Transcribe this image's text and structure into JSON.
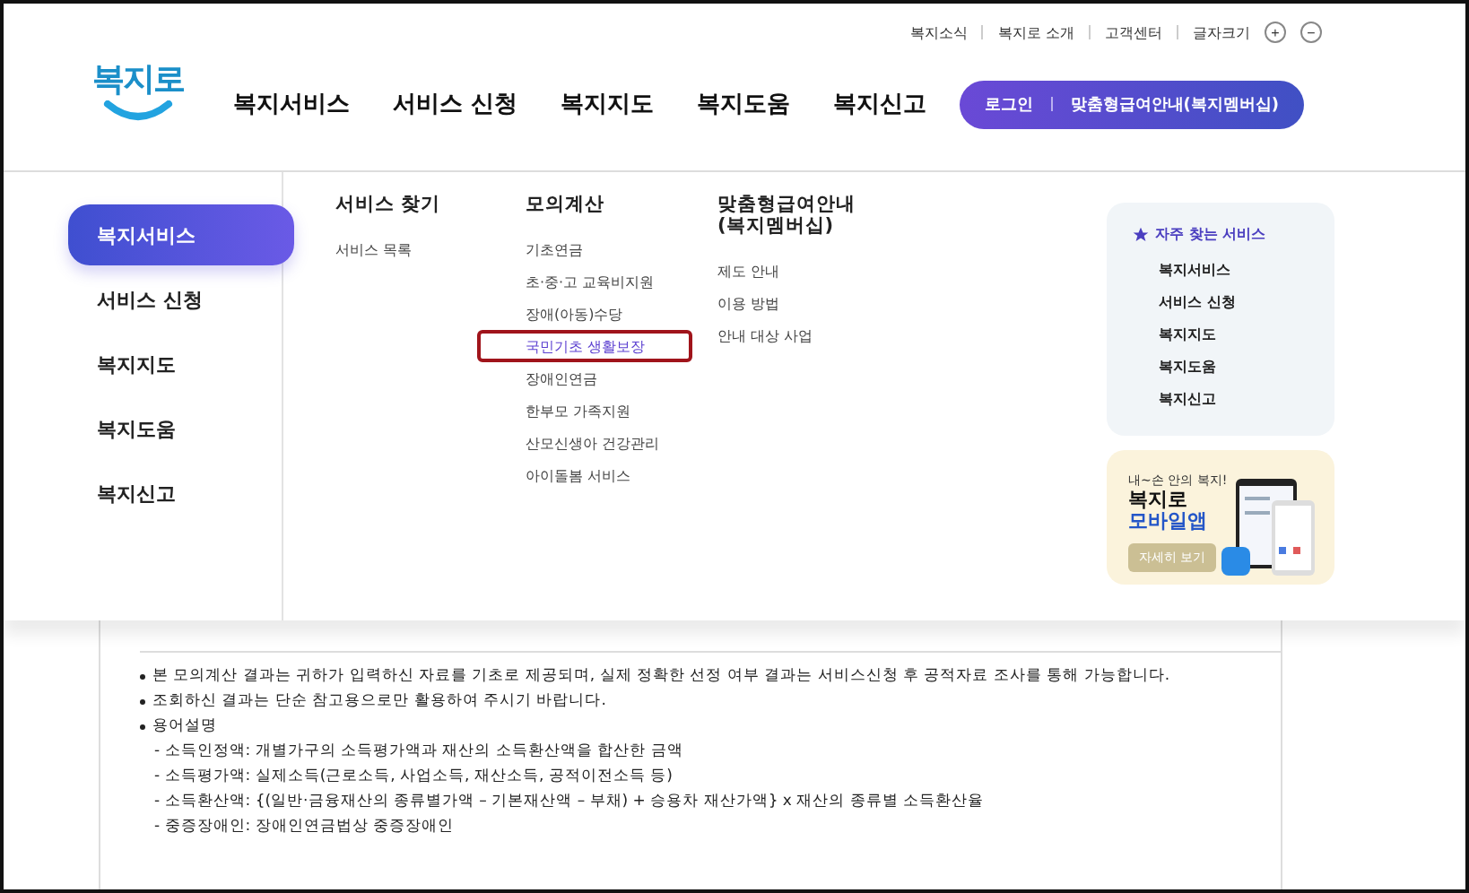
{
  "top_links": [
    "복지소식",
    "복지로 소개",
    "고객센터"
  ],
  "font_size": {
    "label": "글자크기",
    "buttons": [
      "+",
      "−"
    ]
  },
  "logo": "복지로",
  "nav": [
    "복지서비스",
    "서비스 신청",
    "복지지도",
    "복지도움",
    "복지신고"
  ],
  "header_buttons": [
    "로그인",
    "맞춤형급여안내(복지멤버십)"
  ],
  "menu": {
    "sidebar": [
      {
        "label": "복지서비스",
        "selected": true
      },
      {
        "label": "서비스 신청",
        "selected": false
      },
      {
        "label": "복지지도",
        "selected": false
      },
      {
        "label": "복지도움",
        "selected": false
      },
      {
        "label": "복지신고",
        "selected": false
      }
    ],
    "columns": [
      {
        "title": "서비스 찾기",
        "items": [
          {
            "label": "서비스 목록",
            "selected": false
          }
        ]
      },
      {
        "title": "모의계산",
        "items": [
          {
            "label": "기초연금",
            "selected": false
          },
          {
            "label": "초·중·고 교육비지원",
            "selected": false
          },
          {
            "label": "장애(아동)수당",
            "selected": false
          },
          {
            "label": "국민기초 생활보장",
            "selected": true
          },
          {
            "label": "장애인연금",
            "selected": false
          },
          {
            "label": "한부모 가족지원",
            "selected": false
          },
          {
            "label": "산모신생아 건강관리",
            "selected": false
          },
          {
            "label": "아이돌봄 서비스",
            "selected": false
          }
        ]
      },
      {
        "title": "맞춤형급여안내\n(복지멤버십)",
        "items": [
          {
            "label": "제도 안내",
            "selected": false
          },
          {
            "label": "이용 방법",
            "selected": false
          },
          {
            "label": "안내 대상 사업",
            "selected": false
          }
        ]
      }
    ]
  },
  "favorites": {
    "title": "자주 찾는 서비스",
    "items": [
      "복지서비스",
      "서비스 신청",
      "복지지도",
      "복지도움",
      "복지신고"
    ]
  },
  "app_banner": {
    "tagline": "내~손 안의 복지!",
    "title": "복지로",
    "subtitle": "모바일앱",
    "button": "자세히 보기"
  },
  "notes": [
    {
      "text": "본 모의계산 결과는 귀하가 입력하신 자료를 기초로 제공되며, 실제 정확한 선정 여부 결과는 서비스신청 후 공적자료 조사를 통해 가능합니다."
    },
    {
      "text": "조회하신 결과는 단순 참고용으로만 활용하여 주시기 바랍니다."
    },
    {
      "text": "용어설명",
      "children": [
        "- 소득인정액: 개별가구의 소득평가액과 재산의 소득환산액을 합산한 금액",
        "- 소득평가액: 실제소득(근로소득, 사업소득, 재산소득, 공적이전소득 등)",
        "- 소득환산액: {(일반·금융재산의 종류별가액 – 기본재산액 – 부채) + 승용차 재산가액} x 재산의 종류별 소득환산율",
        "- 중증장애인: 장애인연금법상 중증장애인"
      ]
    }
  ]
}
